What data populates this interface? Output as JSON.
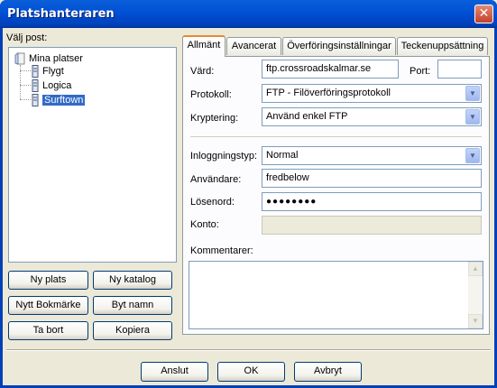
{
  "window": {
    "title": "Platshanteraren",
    "close_glyph": "✕"
  },
  "left": {
    "select_label": "Välj post:",
    "tree": {
      "root": "Mina platser",
      "children": [
        "Flygt",
        "Logica",
        "Surftown"
      ],
      "selected": "Surftown"
    },
    "buttons": {
      "new_site": "Ny plats",
      "new_folder": "Ny katalog",
      "new_bookmark": "Nytt Bokmärke",
      "rename": "Byt namn",
      "delete": "Ta bort",
      "copy": "Kopiera"
    }
  },
  "tabs": [
    "Allmänt",
    "Avancerat",
    "Överföringsinställningar",
    "Teckenuppsättning"
  ],
  "active_tab": "Allmänt",
  "general": {
    "host_label": "Värd:",
    "host_value": "ftp.crossroadskalmar.se",
    "port_label": "Port:",
    "port_value": "",
    "protocol_label": "Protokoll:",
    "protocol_value": "FTP - Filöverföringsprotokoll",
    "encryption_label": "Kryptering:",
    "encryption_value": "Använd enkel FTP",
    "logon_type_label": "Inloggningstyp:",
    "logon_type_value": "Normal",
    "user_label": "Användare:",
    "user_value": "fredbelow",
    "password_label": "Lösenord:",
    "password_value": "●●●●●●●●",
    "account_label": "Konto:",
    "account_value": "",
    "comments_label": "Kommentarer:",
    "comments_value": ""
  },
  "footer": {
    "connect": "Anslut",
    "ok": "OK",
    "cancel": "Avbryt"
  },
  "colors": {
    "titlebar": "#0050d6",
    "selection": "#316ac5",
    "active_tab_accent": "#e68b2c"
  },
  "icons": {
    "folder": "folder-icon",
    "server": "server-icon",
    "dropdown": "chevron-down-icon"
  }
}
